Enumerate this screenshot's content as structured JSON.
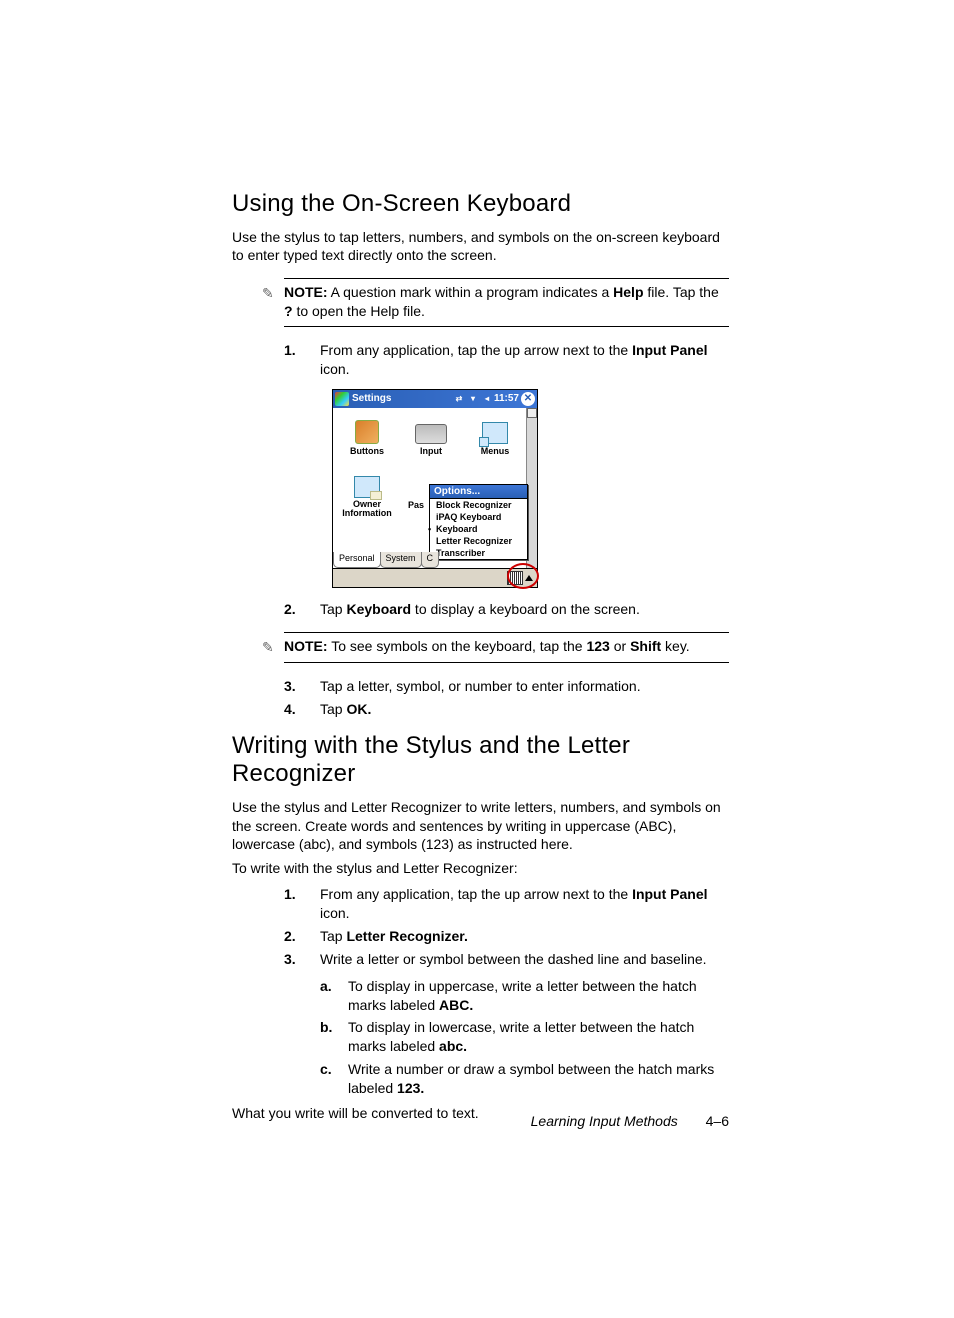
{
  "section1": {
    "heading": "Using the On-Screen Keyboard",
    "intro": "Use the stylus to tap letters, numbers, and symbols on the on-screen keyboard to enter typed text directly onto the screen.",
    "note1_pre": "NOTE:",
    "note1_a": " A question mark within a program indicates a ",
    "note1_help": "Help",
    "note1_b": " file. Tap the ",
    "note1_qmark": "?",
    "note1_c": " to open the Help file.",
    "step1_a": "From any application, tap the up arrow next to the ",
    "step1_b": "Input Panel",
    "step1_c": " icon.",
    "step2_a": "Tap ",
    "step2_b": "Keyboard",
    "step2_c": " to display a keyboard on the screen.",
    "note2_pre": "NOTE:",
    "note2_a": " To see symbols on the keyboard, tap the ",
    "note2_123": "123",
    "note2_b": " or ",
    "note2_shift": "Shift",
    "note2_c": " key.",
    "step3": "Tap a letter, symbol, or number to enter information.",
    "step4_a": "Tap ",
    "step4_b": "OK."
  },
  "screenshot": {
    "title": "Settings",
    "time": "11:57",
    "icons": {
      "buttons": "Buttons",
      "input": "Input",
      "menus": "Menus",
      "owner": "Owner Information",
      "password_trunc": "Pas"
    },
    "popup": {
      "header": "Options...",
      "items": [
        "Block Recognizer",
        "iPAQ Keyboard",
        "Keyboard",
        "Letter Recognizer",
        "Transcriber"
      ],
      "selected_index": 2
    },
    "tabs": [
      "Personal",
      "System",
      "C"
    ]
  },
  "section2": {
    "heading": "Writing with the Stylus and the Letter Recognizer",
    "intro": "Use the stylus and Letter Recognizer to write letters, numbers, and symbols on the screen. Create words and sentences by writing in uppercase (ABC), lowercase (abc), and symbols (123) as instructed here.",
    "lead": "To write with the stylus and Letter Recognizer:",
    "step1_a": "From any application, tap the up arrow next to the ",
    "step1_b": "Input Panel",
    "step1_c": " icon.",
    "step2_a": "Tap ",
    "step2_b": "Letter Recognizer.",
    "step3": "Write a letter or symbol between the dashed line and baseline.",
    "sub_a_a": "To display in uppercase, write a letter between the hatch marks labeled ",
    "sub_a_b": "ABC.",
    "sub_b_a": "To display in lowercase, write a letter between the hatch marks labeled ",
    "sub_b_b": "abc.",
    "sub_c_a": "Write a number or draw a symbol between the hatch marks labeled ",
    "sub_c_b": "123.",
    "closing": "What you write will be converted to text."
  },
  "footer": {
    "chapter": "Learning Input Methods",
    "pagenum": "4–6"
  },
  "nums": {
    "n1": "1.",
    "n2": "2.",
    "n3": "3.",
    "n4": "4.",
    "a": "a.",
    "b": "b.",
    "c": "c."
  }
}
